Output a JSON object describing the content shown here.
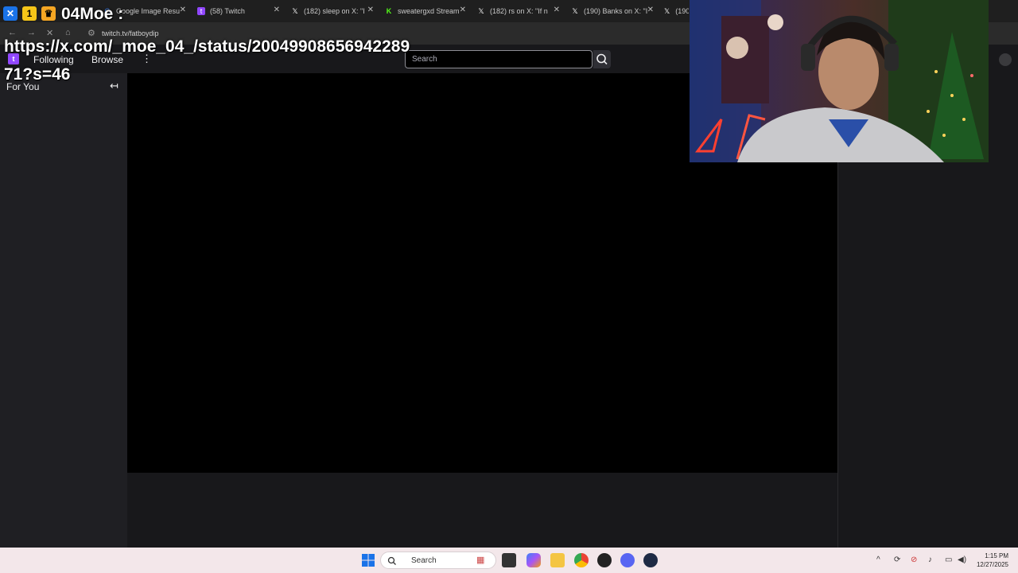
{
  "browser": {
    "tabs": [
      {
        "label": "",
        "favicon": "generic"
      },
      {
        "label": "Google Image Resu",
        "favicon": "google"
      },
      {
        "label": "(58) Twitch",
        "favicon": "twitch"
      },
      {
        "label": "(182) sleep on X: \"I",
        "favicon": "x"
      },
      {
        "label": "sweatergxd Stream",
        "favicon": "kick"
      },
      {
        "label": "(182) rs on X: \"If n",
        "favicon": "x"
      },
      {
        "label": "(190) Banks on X: \"I",
        "favicon": "x"
      },
      {
        "label": "(190",
        "favicon": "x"
      }
    ],
    "address": "twitch.tv/fatboydip"
  },
  "overlay": {
    "name": "04Moe :",
    "url": "https://x.com/_moe_04_/status/2004990865694228971?s=46"
  },
  "twitch": {
    "nav": {
      "following": "Following",
      "browse": "Browse",
      "more": "⋮"
    },
    "search_placeholder": "Search",
    "sidebar": {
      "for_you": "For You",
      "collapse_icon": "↤"
    }
  },
  "taskbar": {
    "search_placeholder": "Search",
    "time": "1:15 PM",
    "date": "12/27/2025"
  },
  "colors": {
    "twitch_purple": "#9147ff",
    "background": "#0e0e10",
    "sidebar": "#1f1f23",
    "taskbar": "#f3e7ea"
  }
}
